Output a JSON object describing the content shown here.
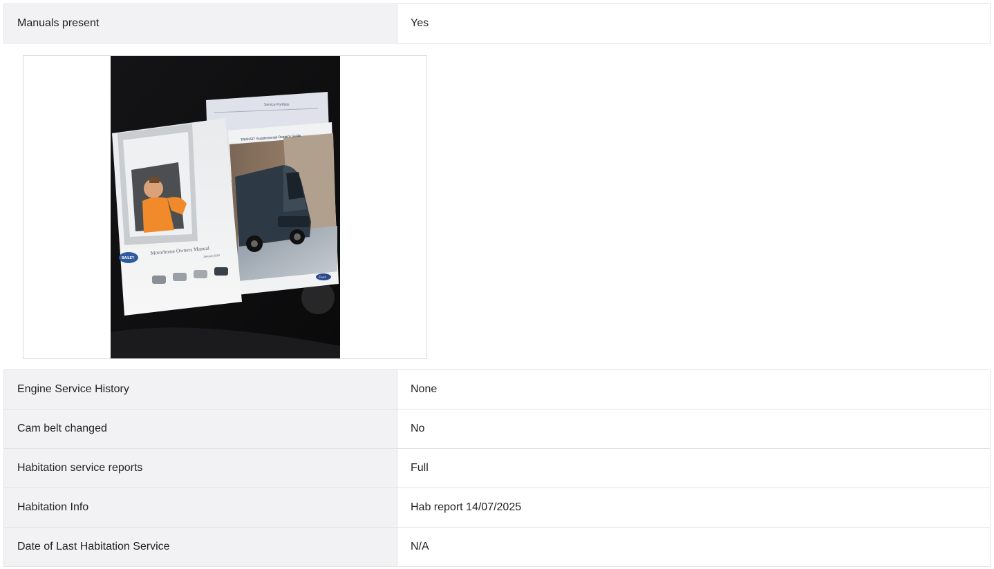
{
  "top_rows": [
    {
      "label": "Manuals present",
      "value": "Yes"
    }
  ],
  "photo": {
    "subject": "owner manuals on black carpet",
    "manual_1": {
      "title": "Motorhome Owners Manual",
      "date": "January 2024",
      "brand": "BAILEY"
    },
    "manual_2": {
      "title": "TRANSIT Supplemental Owner's Guide",
      "brand": "Ford"
    },
    "manual_3": {
      "title": "Service Portfolio"
    }
  },
  "bottom_rows": [
    {
      "label": "Engine Service History",
      "value": "None"
    },
    {
      "label": "Cam belt changed",
      "value": "No"
    },
    {
      "label": "Habitation service reports",
      "value": "Full"
    },
    {
      "label": "Habitation Info",
      "value": "Hab report 14/07/2025"
    },
    {
      "label": "Date of Last Habitation Service",
      "value": "N/A"
    }
  ]
}
